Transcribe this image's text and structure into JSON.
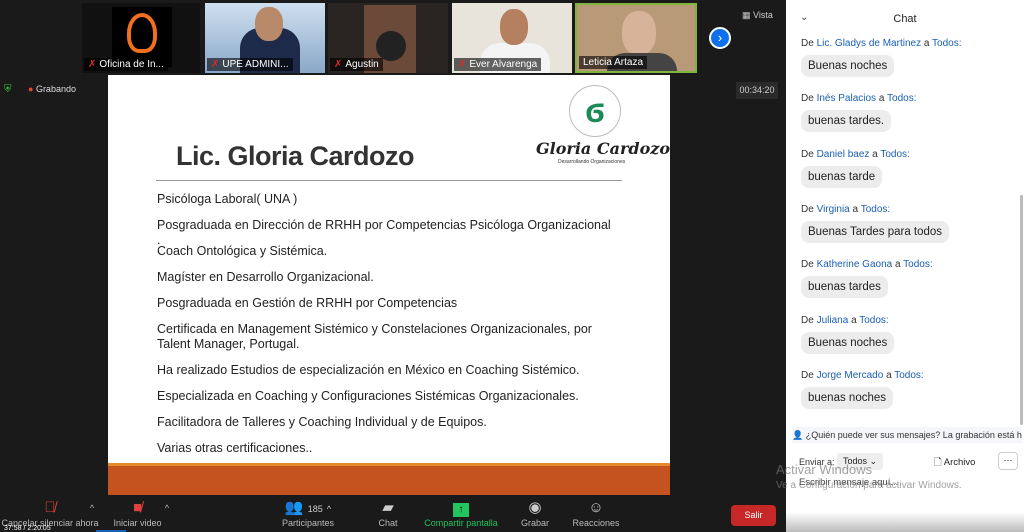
{
  "participants_strip": [
    {
      "name": "Oficina de In...",
      "muted": true
    },
    {
      "name": "UPE ADMINI...",
      "muted": true
    },
    {
      "name": "Agustin",
      "muted": true
    },
    {
      "name": "Ever Alvarenga",
      "muted": true
    },
    {
      "name": "Leticia Artaza",
      "muted": false
    }
  ],
  "view_label": "Vista",
  "recording_label": "Grabando",
  "elapsed": "00:34:20",
  "slide": {
    "title": "Lic. Gloria Cardozo",
    "logo_text": "Gloria Cardozo",
    "logo_tagline": "Desarrollando Organizaciones",
    "items": [
      "Psicóloga Laboral( UNA )",
      "Posgraduada en Dirección de RRHH por Competencias Psicóloga Organizacional .",
      "Coach Ontológica  y Sistémica.",
      "Magíster en Desarrollo Organizacional.",
      "Posgraduada en Gestión de RRHH por Competencias",
      "Certificada en Management Sistémico y Constelaciones Organizacionales, por Talent Manager, Portugal.",
      "Ha realizado Estudios de especialización en México en Coaching Sistémico.",
      "Especializada  en  Coaching y Configuraciones Sistémicas Organizacionales.",
      "Facilitadora de Talleres  y Coaching Individual y de Equipos.",
      "Varias otras certificaciones.."
    ]
  },
  "toolbar": {
    "mute": "Cancelar silenciar ahora",
    "video": "Iniciar video",
    "participants": "Participantes",
    "participants_count": "185",
    "chat": "Chat",
    "share": "Compartir pantalla",
    "record": "Grabar",
    "reactions": "Reacciones",
    "leave": "Salir",
    "playback_time": "37:58 / 2:20:05"
  },
  "chat": {
    "title": "Chat",
    "from_word": "De",
    "to_word": "a",
    "messages": [
      {
        "sender": "Lic. Gladys de Martinez",
        "to": "Todos:",
        "text": "Buenas noches"
      },
      {
        "sender": "Inés Palacios",
        "to": "Todos:",
        "text": "buenas tardes."
      },
      {
        "sender": "Daniel baez",
        "to": "Todos:",
        "text": "buenas tarde"
      },
      {
        "sender": "Virginia",
        "to": "Todos:",
        "text": "Buenas Tardes para todos"
      },
      {
        "sender": "Katherine Gaona",
        "to": "Todos:",
        "text": "buenas tardes"
      },
      {
        "sender": "Juliana",
        "to": "Todos:",
        "text": "Buenas noches"
      },
      {
        "sender": "Jorge Mercado",
        "to": "Todos:",
        "text": "buenas noches"
      }
    ],
    "notice": "¿Quién puede ver sus mensajes? La grabación está habilit",
    "send_to_label": "Enviar a:",
    "send_to_value": "Todos",
    "file_label": "Archivo",
    "input_placeholder": "Escribir mensaje aquí..."
  },
  "watermark": {
    "line1": "Activar Windows",
    "line2": "Ve a Configuración para activar Windows."
  },
  "colors": {
    "accent": "#0e71eb",
    "leave": "#c62828",
    "share": "#22c55e",
    "slide_bar": "#c4531f"
  }
}
